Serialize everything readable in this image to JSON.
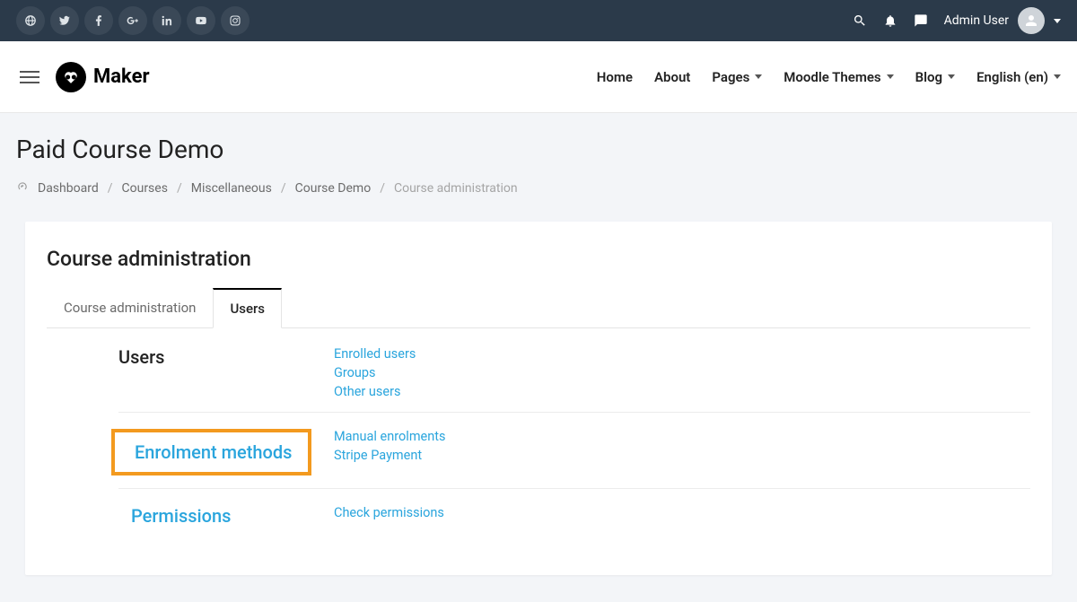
{
  "topbar": {
    "user_name": "Admin User"
  },
  "brand": {
    "name": "Maker"
  },
  "nav": {
    "home": "Home",
    "about": "About",
    "pages": "Pages",
    "themes": "Moodle Themes",
    "blog": "Blog",
    "lang": "English (en)"
  },
  "page": {
    "title": "Paid Course Demo"
  },
  "breadcrumb": {
    "dashboard": "Dashboard",
    "courses": "Courses",
    "misc": "Miscellaneous",
    "course_demo": "Course Demo",
    "current": "Course administration"
  },
  "card": {
    "title": "Course administration",
    "tabs": {
      "admin": "Course administration",
      "users": "Users"
    },
    "sections": {
      "users": {
        "label": "Users",
        "links": {
          "enrolled": "Enrolled users",
          "groups": "Groups",
          "other": "Other users"
        }
      },
      "enrolment": {
        "label": "Enrolment methods",
        "links": {
          "manual": "Manual enrolments",
          "stripe": "Stripe Payment"
        }
      },
      "permissions": {
        "label": "Permissions",
        "links": {
          "check": "Check permissions"
        }
      }
    }
  }
}
